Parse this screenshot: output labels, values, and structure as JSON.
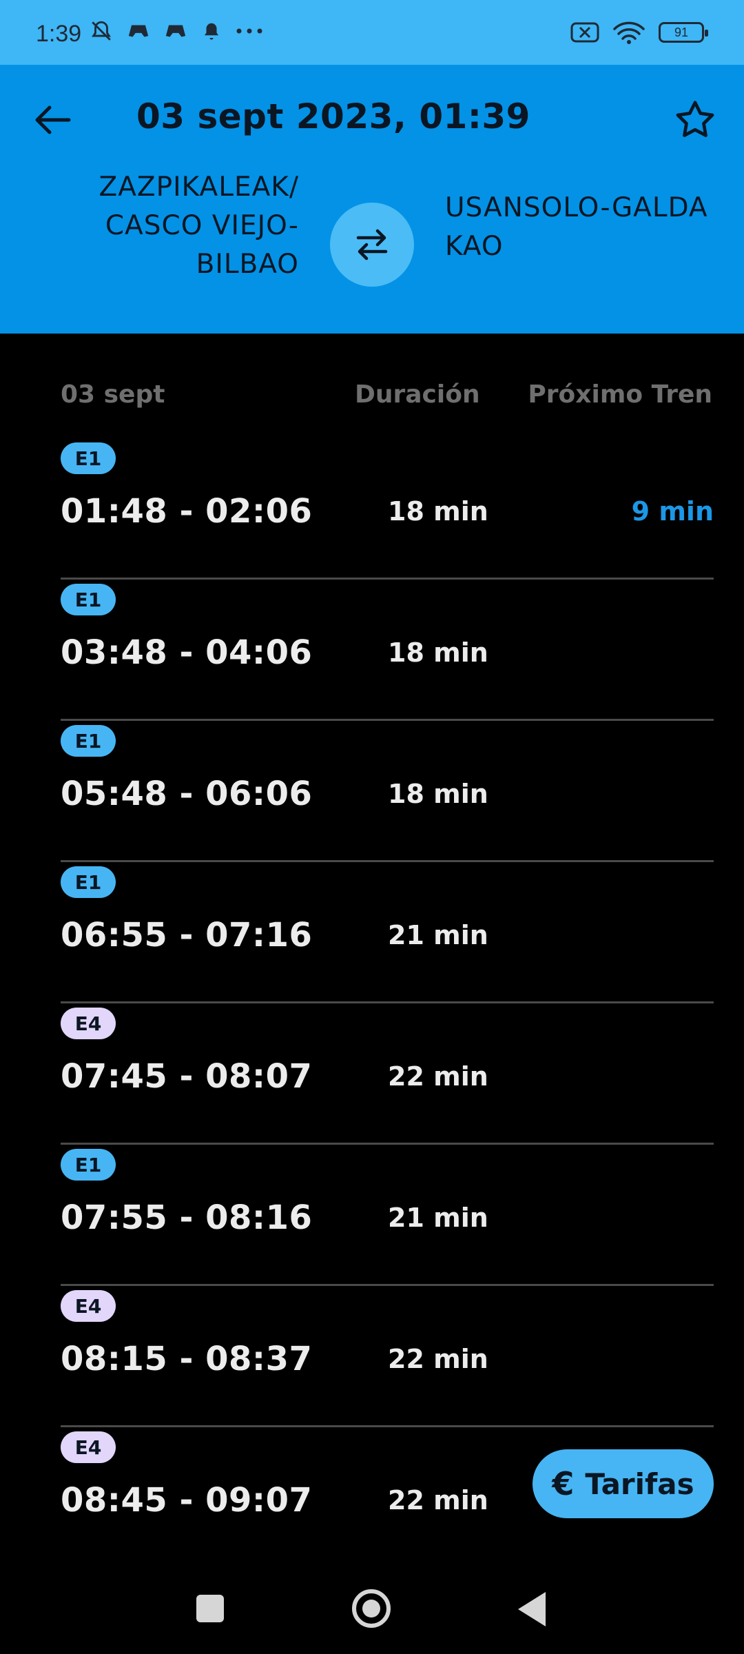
{
  "status": {
    "time": "1:39",
    "battery": "91",
    "icons_left": [
      "mute-icon",
      "game-icon",
      "game-icon",
      "bell-icon",
      "more-icon"
    ],
    "icons_right": [
      "sim-off-icon",
      "wifi-icon",
      "battery-icon"
    ]
  },
  "header": {
    "title": "03 sept 2023, 01:39",
    "origin": "ZAZPIKALEAK/ CASCO VIEJO-BILBAO",
    "destination": "USANSOLO-GALDAKAO",
    "colors": {
      "background": "#0392e6",
      "swap_button": "#4bbcf5"
    }
  },
  "columns": {
    "date": "03 sept",
    "duration": "Duración",
    "next_train": "Próximo Tren"
  },
  "trips": [
    {
      "line": "E1",
      "times": "01:48 - 02:06",
      "duration": "18 min",
      "next": "9 min"
    },
    {
      "line": "E1",
      "times": "03:48 - 04:06",
      "duration": "18 min",
      "next": ""
    },
    {
      "line": "E1",
      "times": "05:48 - 06:06",
      "duration": "18 min",
      "next": ""
    },
    {
      "line": "E1",
      "times": "06:55 - 07:16",
      "duration": "21 min",
      "next": ""
    },
    {
      "line": "E4",
      "times": "07:45 - 08:07",
      "duration": "22 min",
      "next": ""
    },
    {
      "line": "E1",
      "times": "07:55 - 08:16",
      "duration": "21 min",
      "next": ""
    },
    {
      "line": "E4",
      "times": "08:15 - 08:37",
      "duration": "22 min",
      "next": ""
    },
    {
      "line": "E4",
      "times": "08:45 - 09:07",
      "duration": "22 min",
      "next": ""
    }
  ],
  "line_colors": {
    "E1": "#47b5f3",
    "E4": "#e2d6fb"
  },
  "fab": {
    "label": "Tarifas",
    "icon": "€"
  }
}
